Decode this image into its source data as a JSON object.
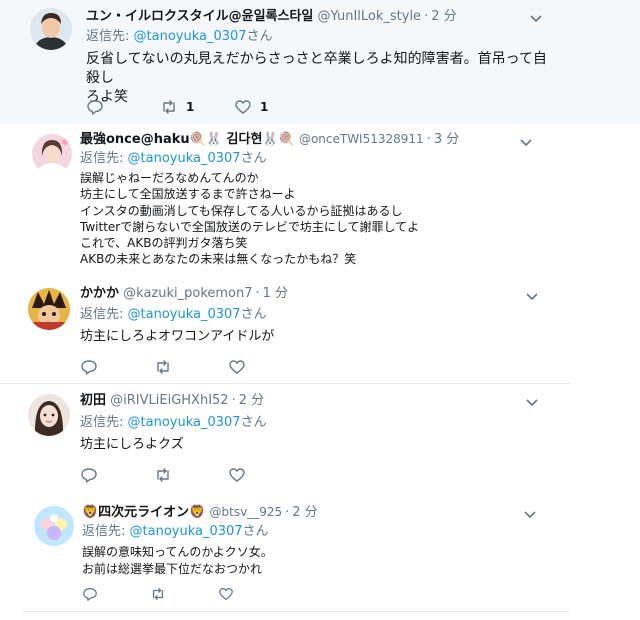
{
  "tweets": [
    {
      "name": "ユン・イルロクスタイル@윤일록스타일",
      "handle": "@YunIlLok_style",
      "time": "2 分",
      "reply_prefix": "返信先:",
      "reply_mention": "@tanoyuka_0307",
      "reply_suffix": "さん",
      "lines": [
        "反省してないの丸見えだからさっさと卒業しろよ知的障害者。首吊って自殺し",
        "ろよ笑"
      ],
      "retweet_count": "1",
      "like_count": "1"
    },
    {
      "name": "最強once@haku🍭🐰 김다현🐰🍭",
      "handle": "@onceTWI51328911",
      "time": "3 分",
      "reply_prefix": "返信先:",
      "reply_mention": "@tanoyuka_0307",
      "reply_suffix": "さん",
      "lines": [
        "誤解じゃねーだろなめんてんのか",
        "坊主にして全国放送するまで許さねーよ",
        "インスタの動画消しても保存してる人いるから証拠はあるし",
        "Twitterで謝らないで全国放送のテレビで坊主にして謝罪してよ",
        "これで、AKBの評判ガタ落ち笑",
        "AKBの未来とあなたの未来は無くなったかもね？笑"
      ]
    },
    {
      "name": "かかか",
      "handle": "@kazuki_pokemon7",
      "time": "1 分",
      "reply_prefix": "返信先:",
      "reply_mention": "@tanoyuka_0307",
      "reply_suffix": "さん",
      "lines": [
        "坊主にしろよオワコンアイドルが"
      ]
    },
    {
      "name": "初田",
      "handle": "@iRIVLiEiGHXhI52",
      "time": "2 分",
      "reply_prefix": "返信先:",
      "reply_mention": "@tanoyuka_0307",
      "reply_suffix": "さん",
      "lines": [
        "坊主にしろよクズ"
      ]
    },
    {
      "name": "🦁四次元ライオン🦁",
      "handle": "@btsv__925",
      "time": "2 分",
      "reply_prefix": "返信先:",
      "reply_mention": "@tanoyuka_0307",
      "reply_suffix": "さん",
      "lines": [
        "誤解の意味知ってんのかよクソ女。",
        "お前は総選挙最下位だなおつかれ"
      ]
    }
  ],
  "icons": {
    "reply": "reply-icon",
    "retweet": "retweet-icon",
    "like": "heart-icon",
    "more": "chevron-down-icon"
  },
  "colors": {
    "highlight_bg": "#f5f8fa",
    "link": "#1b95e0",
    "muted": "#657786",
    "text": "#14171a"
  }
}
